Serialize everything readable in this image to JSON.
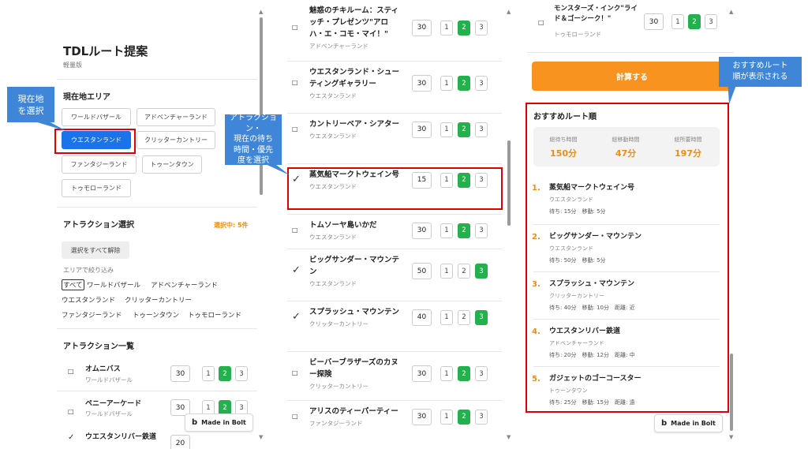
{
  "left": {
    "title": "TDLルート提案",
    "subtitle": "軽量版",
    "area_section": "現在地エリア",
    "areas": [
      "ワールドバザール",
      "アドベンチャーランド",
      "ウエスタンランド",
      "クリッターカントリー",
      "ファンタジーランド",
      "トゥーンタウン",
      "トゥモローランド"
    ],
    "selected_area": "ウエスタンランド",
    "attraction_section": "アトラクション選択",
    "selected_count": "選択中: 5件",
    "clear_all": "選択をすべて解除",
    "filter_label": "エリアで絞り込み",
    "filters": [
      "すべて",
      "ワールドバザール",
      "アドベンチャーランド",
      "ウエスタンランド",
      "クリッターカントリー",
      "ファンタジーランド",
      "トゥーンタウン",
      "トゥモローランド"
    ],
    "list_section": "アトラクション一覧",
    "rows": [
      {
        "mark": "□",
        "name": "オムニバス",
        "area": "ワールドバザール",
        "wait": "30",
        "p": [
          "1",
          "2",
          "3"
        ]
      },
      {
        "mark": "□",
        "name": "ペニーアーケード",
        "area": "ワールドバザール",
        "wait": "30",
        "p": [
          "1",
          "2",
          "3"
        ]
      },
      {
        "mark": "✓",
        "name": "ウエスタンリバー鉄道",
        "area": "",
        "wait": "20",
        "p": [
          "1",
          "2",
          "3"
        ]
      }
    ]
  },
  "middle": {
    "rows": [
      {
        "mark": "□",
        "name": "魅惑のチキルーム：スティッチ・プレゼンツ\"アロハ・エ・コモ・マイ！\"",
        "area": "アドベンチャーランド",
        "wait": "30",
        "active": "2"
      },
      {
        "mark": "□",
        "name": "ウエスタンランド・シューティングギャラリー",
        "area": "ウエスタンランド",
        "wait": "30",
        "active": "2"
      },
      {
        "mark": "□",
        "name": "カントリーベア・シアター",
        "area": "ウエスタンランド",
        "wait": "30",
        "active": "2"
      },
      {
        "mark": "✓",
        "name": "蒸気船マークトウェイン号",
        "area": "ウエスタンランド",
        "wait": "15",
        "active": "2"
      },
      {
        "mark": "□",
        "name": "トムソーヤ島いかだ",
        "area": "ウエスタンランド",
        "wait": "30",
        "active": "2"
      },
      {
        "mark": "✓",
        "name": "ビッグサンダー・マウンテン",
        "area": "ウエスタンランド",
        "wait": "50",
        "active": "3"
      },
      {
        "mark": "✓",
        "name": "スプラッシュ・マウンテン",
        "area": "クリッターカントリー",
        "wait": "40",
        "active": "3"
      },
      {
        "mark": "□",
        "name": "ビーバーブラザーズのカヌー探険",
        "area": "クリッターカントリー",
        "wait": "30",
        "active": "2"
      },
      {
        "mark": "□",
        "name": "アリスのティーパーティー",
        "area": "ファンタジーランド",
        "wait": "30",
        "active": "2"
      }
    ]
  },
  "right": {
    "top_row": {
      "mark": "□",
      "name": "モンスターズ・インク\"ライド＆ゴーシーク！\"",
      "area": "トゥモローランド",
      "wait": "30",
      "active": "2"
    },
    "calc_button": "計算する",
    "result_title": "おすすめルート順",
    "stats": [
      {
        "label": "総待ち時間",
        "value": "150分"
      },
      {
        "label": "総移動時間",
        "value": "47分"
      },
      {
        "label": "総所要時間",
        "value": "197分"
      }
    ],
    "results": [
      {
        "num": "1.",
        "name": "蒸気船マークトウェイン号",
        "area": "ウエスタンランド",
        "meta": "待ち: 15分　移動: 5分"
      },
      {
        "num": "2.",
        "name": "ビッグサンダー・マウンテン",
        "area": "ウエスタンランド",
        "meta": "待ち: 50分　移動: 5分"
      },
      {
        "num": "3.",
        "name": "スプラッシュ・マウンテン",
        "area": "クリッターカントリー",
        "meta": "待ち: 40分　移動: 10分　距離: 近"
      },
      {
        "num": "4.",
        "name": "ウエスタンリバー鉄道",
        "area": "アドベンチャーランド",
        "meta": "待ち: 20分　移動: 12分　距離: 中"
      },
      {
        "num": "5.",
        "name": "ガジェットのゴーコースター",
        "area": "トゥーンタウン",
        "meta": "待ち: 25分　移動: 15分　距離: 遠"
      }
    ]
  },
  "badge": "Made in Bolt",
  "callouts": {
    "c1": "現在地\nを選択",
    "c2": "アトラクション・\n現在の待ち\n時間・優先\n度を選択",
    "c3": "おすすめルート\n順が表示される"
  },
  "colors": {
    "accent": "#1a73e8",
    "priority": "#22b14c",
    "orange": "#f7931e",
    "highlight": "#e00000",
    "callout": "#3f86d8"
  }
}
